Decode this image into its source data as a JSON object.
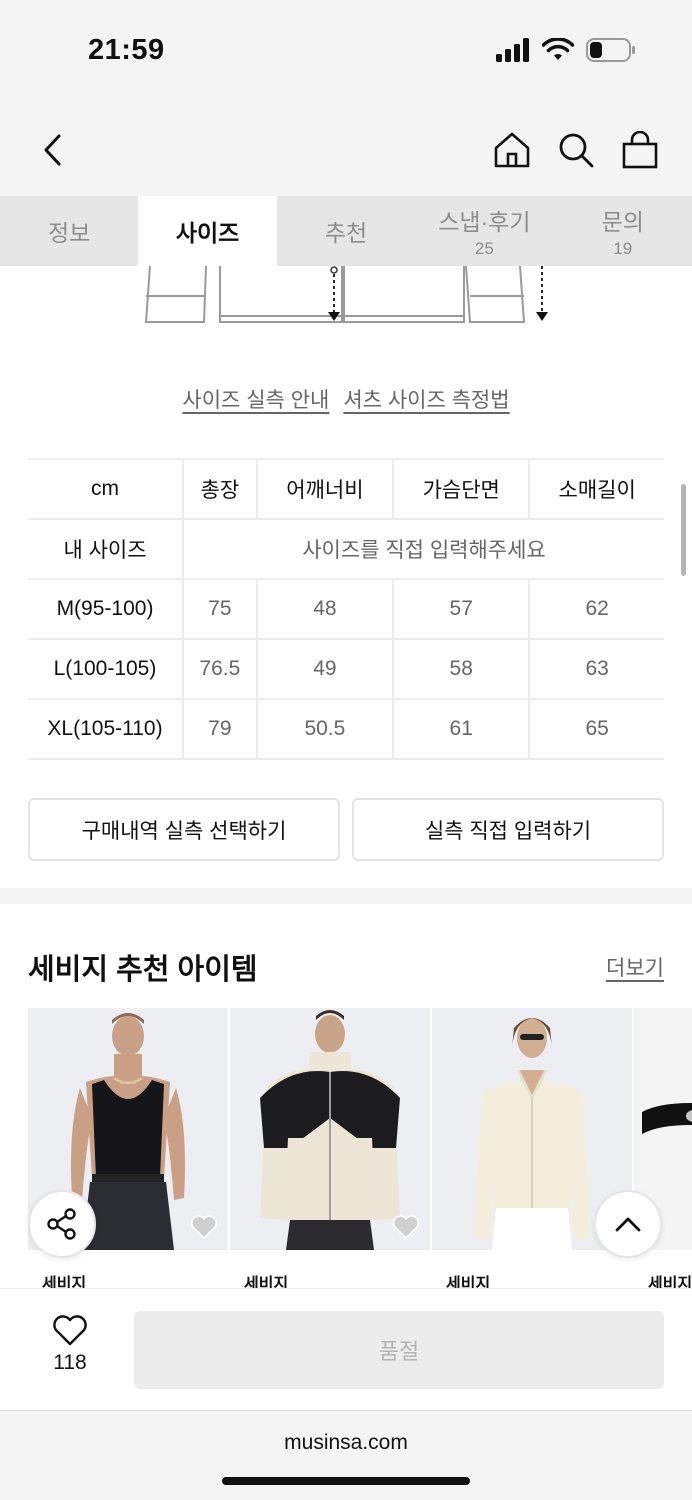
{
  "status_bar": {
    "time": "21:59"
  },
  "header": {
    "back_icon": "chevron-left-icon",
    "icons": [
      "home-icon",
      "search-icon",
      "bag-icon"
    ]
  },
  "tabs": [
    {
      "label": "정보",
      "count": ""
    },
    {
      "label": "사이즈",
      "count": "",
      "active": true
    },
    {
      "label": "추천",
      "count": ""
    },
    {
      "label": "스냅·후기",
      "count": "25"
    },
    {
      "label": "문의",
      "count": "19"
    }
  ],
  "size_links": {
    "guide": "사이즈 실측 안내",
    "measure": "셔츠 사이즈 측정법"
  },
  "size_table": {
    "headers": [
      "cm",
      "총장",
      "어깨너비",
      "가슴단면",
      "소매길이"
    ],
    "my_size_label": "내 사이즈",
    "my_size_placeholder": "사이즈를 직접 입력해주세요",
    "rows": [
      {
        "size": "M(95-100)",
        "values": [
          "75",
          "48",
          "57",
          "62"
        ]
      },
      {
        "size": "L(100-105)",
        "values": [
          "76.5",
          "49",
          "58",
          "63"
        ]
      },
      {
        "size": "XL(105-110)",
        "values": [
          "79",
          "50.5",
          "61",
          "65"
        ]
      }
    ]
  },
  "actions": {
    "select_purchase": "구매내역 실측 선택하기",
    "direct_input": "실측 직접 입력하기"
  },
  "recommend": {
    "title": "세비지 추천 아이템",
    "more": "더보기",
    "products": [
      {
        "brand": "세비지"
      },
      {
        "brand": "세비지"
      },
      {
        "brand": "세비지"
      },
      {
        "brand": "세비지"
      }
    ]
  },
  "bottom": {
    "like_count": "118",
    "soldout_label": "품절"
  },
  "browser": {
    "url": "musinsa.com"
  }
}
